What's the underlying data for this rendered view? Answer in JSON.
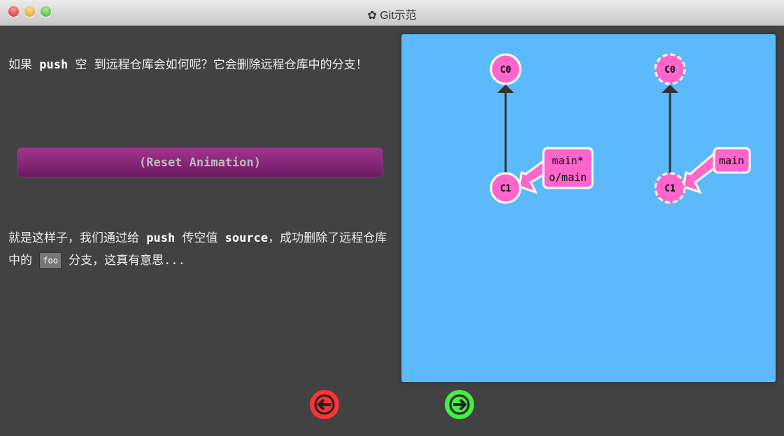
{
  "window": {
    "title": "Git示范",
    "icon": "gear-icon"
  },
  "text1": {
    "a": "如果 ",
    "b": "push",
    "c": " 空 到远程仓库会如何呢？它会删除远程仓库中的分支！"
  },
  "reset_label": "(Reset Animation)",
  "text2": {
    "a": "就是这样子，我们通过给 ",
    "b": "push",
    "c": " 传空值 ",
    "d": "source",
    "e": "，成功删除了远程仓库中的 ",
    "code": "foo",
    "f": " 分支，这真有意思..."
  },
  "graph": {
    "local": {
      "commits": [
        "C0",
        "C1"
      ],
      "branch_lines": [
        "main*",
        "o/main"
      ]
    },
    "remote": {
      "commits": [
        "C0",
        "C1"
      ],
      "branch": "main"
    },
    "colors": {
      "background": "#5cbafc",
      "commit": "#ff66cc",
      "edge": "#333333"
    }
  },
  "nav": {
    "back": "back-arrow-icon",
    "forward": "forward-arrow-icon",
    "back_color": "#ff3333",
    "forward_color": "#44ee44"
  }
}
